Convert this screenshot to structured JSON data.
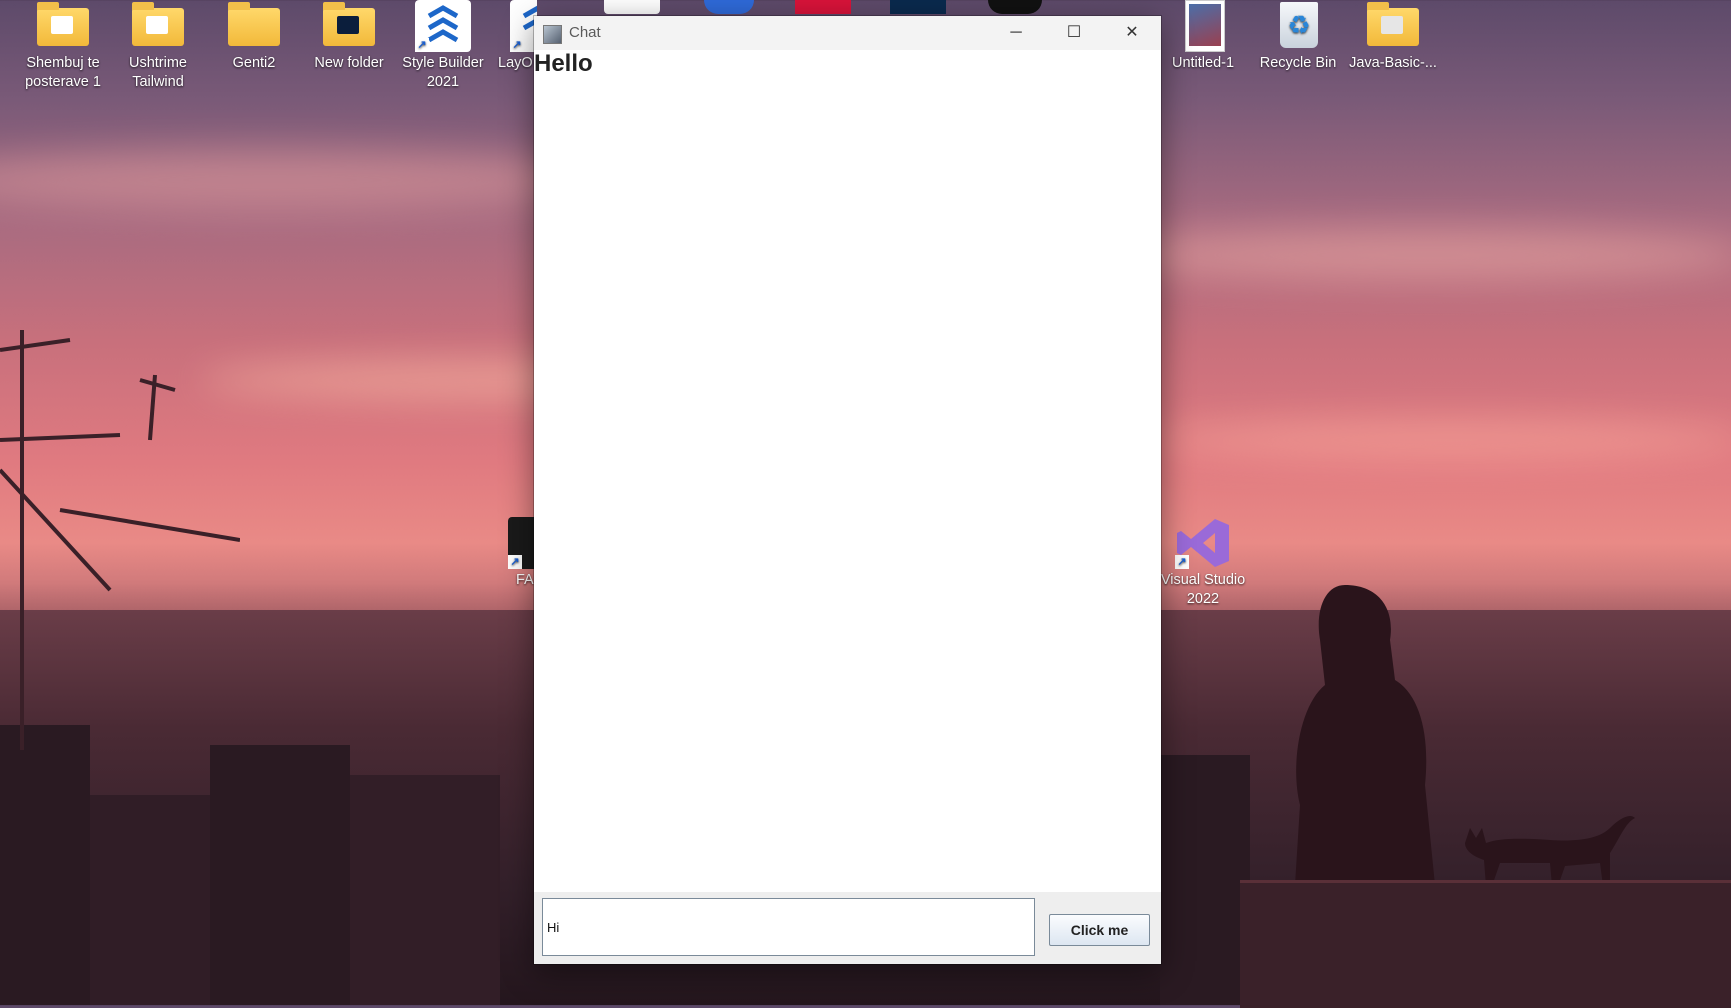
{
  "desktop": {
    "icons": [
      {
        "label": "Shembuj te posterave 1",
        "icon": "folder-icon"
      },
      {
        "label": "Ushtrime Tailwind",
        "icon": "folder-icon"
      },
      {
        "label": "Genti2",
        "icon": "folder-icon"
      },
      {
        "label": "New folder",
        "icon": "folder-icon"
      },
      {
        "label": "Style Builder 2021",
        "icon": "style-builder-icon"
      },
      {
        "label": "LayO",
        "icon": "style-builder-icon"
      },
      {
        "label": "Untitled-1",
        "icon": "image-file-icon"
      },
      {
        "label": "Recycle Bin",
        "icon": "recycle-bin-icon"
      },
      {
        "label": "Java-Basic-...",
        "icon": "folder-icon"
      },
      {
        "label": "FA",
        "icon": "app-icon"
      },
      {
        "label": "Visual Studio 2022",
        "icon": "visual-studio-icon"
      }
    ]
  },
  "window": {
    "title": "Chat",
    "heading": "Hello",
    "input_value": "Hi",
    "button_label": "Click me",
    "controls": {
      "minimize": "─",
      "maximize": "☐",
      "close": "✕"
    }
  },
  "colors": {
    "titlebar": "#f3f3f3",
    "button_border": "#7a8a99"
  }
}
